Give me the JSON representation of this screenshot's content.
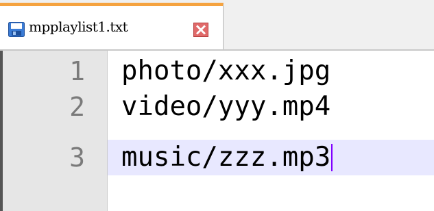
{
  "tab": {
    "filename": "mpplaylist1.txt",
    "icon": "save-icon",
    "close_icon": "close-icon",
    "accent_color": "#f5a340"
  },
  "editor": {
    "lines": [
      {
        "number": "1",
        "text": "photo/xxx.jpg"
      },
      {
        "number": "2",
        "text": "video/yyy.mp4"
      },
      {
        "number": "3",
        "text": "music/zzz.mp3"
      }
    ],
    "current_line": 3,
    "caret_color": "#8000ff",
    "current_line_color": "#e8e8ff"
  }
}
